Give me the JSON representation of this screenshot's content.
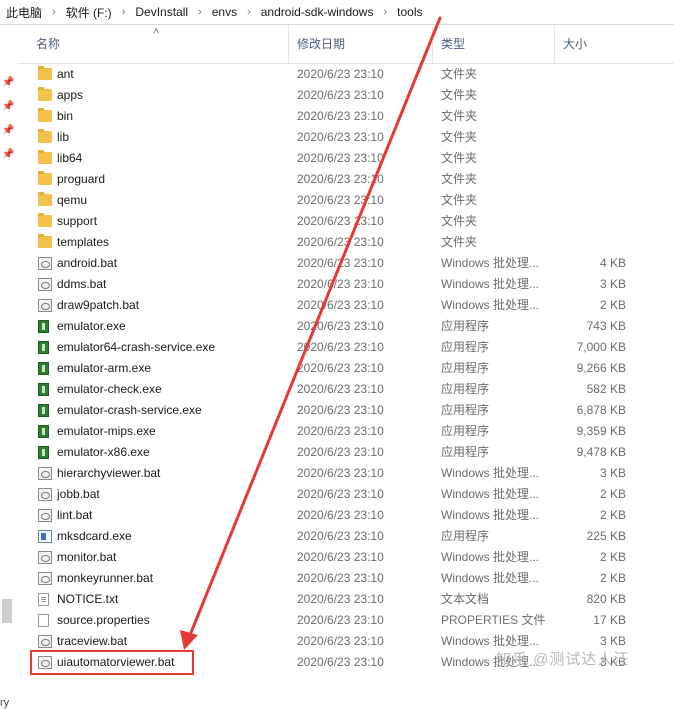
{
  "breadcrumb": [
    "此电脑",
    "软件 (F:)",
    "DevInstall",
    "envs",
    "android-sdk-windows",
    "tools"
  ],
  "columns": {
    "name": "名称",
    "modified": "修改日期",
    "type": "类型",
    "size": "大小"
  },
  "nav_fragment": "ry",
  "files": [
    {
      "name": "ant",
      "modified": "2020/6/23 23:10",
      "type": "文件夹",
      "size": "",
      "icon": "folder-icon"
    },
    {
      "name": "apps",
      "modified": "2020/6/23 23:10",
      "type": "文件夹",
      "size": "",
      "icon": "folder-icon"
    },
    {
      "name": "bin",
      "modified": "2020/6/23 23:10",
      "type": "文件夹",
      "size": "",
      "icon": "folder-icon"
    },
    {
      "name": "lib",
      "modified": "2020/6/23 23:10",
      "type": "文件夹",
      "size": "",
      "icon": "folder-icon"
    },
    {
      "name": "lib64",
      "modified": "2020/6/23 23:10",
      "type": "文件夹",
      "size": "",
      "icon": "folder-icon"
    },
    {
      "name": "proguard",
      "modified": "2020/6/23 23:10",
      "type": "文件夹",
      "size": "",
      "icon": "folder-icon"
    },
    {
      "name": "qemu",
      "modified": "2020/6/23 23:10",
      "type": "文件夹",
      "size": "",
      "icon": "folder-icon"
    },
    {
      "name": "support",
      "modified": "2020/6/23 23:10",
      "type": "文件夹",
      "size": "",
      "icon": "folder-icon"
    },
    {
      "name": "templates",
      "modified": "2020/6/23 23:10",
      "type": "文件夹",
      "size": "",
      "icon": "folder-icon"
    },
    {
      "name": "android.bat",
      "modified": "2020/6/23 23:10",
      "type": "Windows 批处理...",
      "size": "4 KB",
      "icon": "batch-file-icon"
    },
    {
      "name": "ddms.bat",
      "modified": "2020/6/23 23:10",
      "type": "Windows 批处理...",
      "size": "3 KB",
      "icon": "batch-file-icon"
    },
    {
      "name": "draw9patch.bat",
      "modified": "2020/6/23 23:10",
      "type": "Windows 批处理...",
      "size": "2 KB",
      "icon": "batch-file-icon"
    },
    {
      "name": "emulator.exe",
      "modified": "2020/6/23 23:10",
      "type": "应用程序",
      "size": "743 KB",
      "icon": "exe-icon"
    },
    {
      "name": "emulator64-crash-service.exe",
      "modified": "2020/6/23 23:10",
      "type": "应用程序",
      "size": "7,000 KB",
      "icon": "exe-icon"
    },
    {
      "name": "emulator-arm.exe",
      "modified": "2020/6/23 23:10",
      "type": "应用程序",
      "size": "9,266 KB",
      "icon": "exe-icon"
    },
    {
      "name": "emulator-check.exe",
      "modified": "2020/6/23 23:10",
      "type": "应用程序",
      "size": "582 KB",
      "icon": "exe-icon"
    },
    {
      "name": "emulator-crash-service.exe",
      "modified": "2020/6/23 23:10",
      "type": "应用程序",
      "size": "6,878 KB",
      "icon": "exe-icon"
    },
    {
      "name": "emulator-mips.exe",
      "modified": "2020/6/23 23:10",
      "type": "应用程序",
      "size": "9,359 KB",
      "icon": "exe-icon"
    },
    {
      "name": "emulator-x86.exe",
      "modified": "2020/6/23 23:10",
      "type": "应用程序",
      "size": "9,478 KB",
      "icon": "exe-icon"
    },
    {
      "name": "hierarchyviewer.bat",
      "modified": "2020/6/23 23:10",
      "type": "Windows 批处理...",
      "size": "3 KB",
      "icon": "batch-file-icon"
    },
    {
      "name": "jobb.bat",
      "modified": "2020/6/23 23:10",
      "type": "Windows 批处理...",
      "size": "2 KB",
      "icon": "batch-file-icon"
    },
    {
      "name": "lint.bat",
      "modified": "2020/6/23 23:10",
      "type": "Windows 批处理...",
      "size": "2 KB",
      "icon": "batch-file-icon"
    },
    {
      "name": "mksdcard.exe",
      "modified": "2020/6/23 23:10",
      "type": "应用程序",
      "size": "225 KB",
      "icon": "mksdcard-app-icon"
    },
    {
      "name": "monitor.bat",
      "modified": "2020/6/23 23:10",
      "type": "Windows 批处理...",
      "size": "2 KB",
      "icon": "batch-file-icon"
    },
    {
      "name": "monkeyrunner.bat",
      "modified": "2020/6/23 23:10",
      "type": "Windows 批处理...",
      "size": "2 KB",
      "icon": "batch-file-icon"
    },
    {
      "name": "NOTICE.txt",
      "modified": "2020/6/23 23:10",
      "type": "文本文档",
      "size": "820 KB",
      "icon": "text-file-icon"
    },
    {
      "name": "source.properties",
      "modified": "2020/6/23 23:10",
      "type": "PROPERTIES 文件",
      "size": "17 KB",
      "icon": "properties-file-icon"
    },
    {
      "name": "traceview.bat",
      "modified": "2020/6/23 23:10",
      "type": "Windows 批处理...",
      "size": "3 KB",
      "icon": "batch-file-icon"
    },
    {
      "name": "uiautomatorviewer.bat",
      "modified": "2020/6/23 23:10",
      "type": "Windows 批处理...",
      "size": "3 KB",
      "icon": "batch-file-icon"
    }
  ],
  "annotation": {
    "highlight_color": "#e53935",
    "highlighted_file": "uiautomatorviewer.bat"
  },
  "watermark": "知乎 @测试达人汪"
}
